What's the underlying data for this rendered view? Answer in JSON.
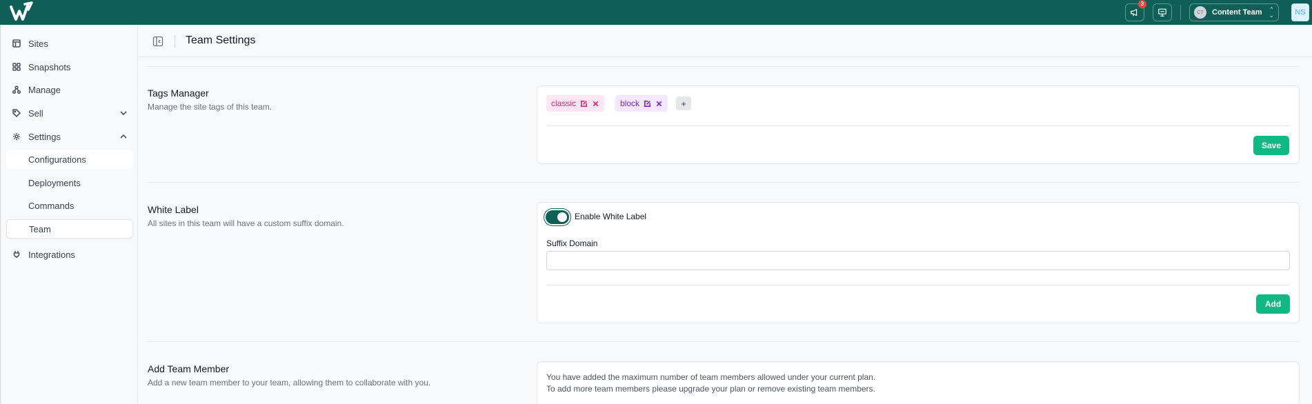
{
  "topbar": {
    "notification_count": "3",
    "team_initials": "CT",
    "team_name": "Content Team",
    "user_initials": "NS"
  },
  "sidebar": {
    "items": [
      {
        "label": "Sites",
        "icon": "layout-icon"
      },
      {
        "label": "Snapshots",
        "icon": "grid-icon"
      },
      {
        "label": "Manage",
        "icon": "nodes-icon"
      },
      {
        "label": "Sell",
        "icon": "tag-icon"
      },
      {
        "label": "Settings",
        "icon": "gear-icon"
      },
      {
        "label": "Integrations",
        "icon": "plug-icon"
      }
    ],
    "settings_sub": [
      "Configurations",
      "Deployments",
      "Commands",
      "Team"
    ],
    "active": "Team"
  },
  "header": {
    "title": "Team Settings"
  },
  "tags_manager": {
    "title": "Tags Manager",
    "description": "Manage the site tags of this team.",
    "tags": [
      "classic",
      "block"
    ],
    "add_label": "+",
    "save_label": "Save"
  },
  "white_label": {
    "title": "White Label",
    "description": "All sites in this team will have a custom suffix domain.",
    "toggle_label": "Enable White Label",
    "toggle_on": true,
    "suffix_label": "Suffix Domain",
    "suffix_value": "",
    "add_label": "Add"
  },
  "add_member": {
    "title": "Add Team Member",
    "description": "Add a new team member to your team, allowing them to collaborate with you.",
    "note": "You have added the maximum number of team members allowed under your current plan. To add more team members please upgrade your plan or remove existing team members."
  },
  "colors": {
    "brand": "#0f5f57",
    "accent_green": "#10b981",
    "tag_pink": "#db2777",
    "tag_purple": "#7e22ce",
    "badge_red": "#ef4444"
  }
}
